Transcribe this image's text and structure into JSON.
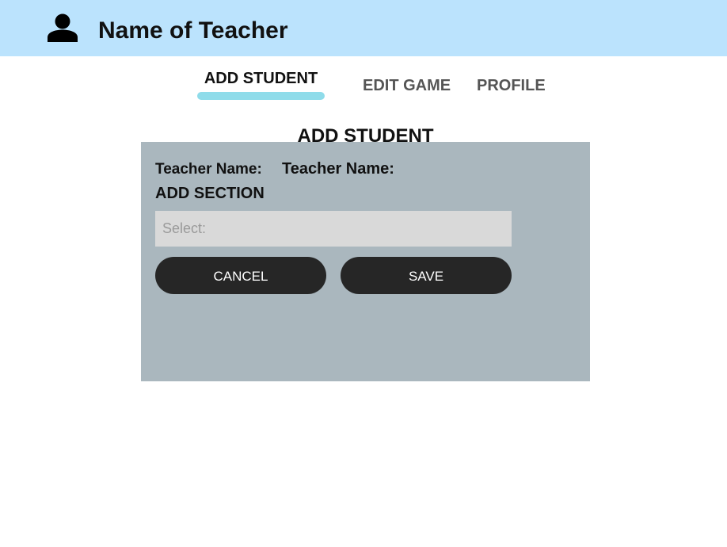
{
  "header": {
    "icon": "user-icon",
    "title": "Name of Teacher"
  },
  "tabs": [
    {
      "label": "ADD STUDENT",
      "active": true
    },
    {
      "label": "EDIT GAME",
      "active": false
    },
    {
      "label": "PROFILE",
      "active": false
    }
  ],
  "main": {
    "heading": "ADD STUDENT",
    "form": {
      "teacher_label": "Teacher Name:",
      "teacher_value": "Teacher Name:",
      "section_label": "ADD SECTION",
      "select_placeholder": "Select:",
      "cancel_label": "CANCEL",
      "save_label": "SAVE"
    }
  },
  "colors": {
    "header_bg": "#bbe3fd",
    "active_tab_indicator": "#8fdcea",
    "panel_bg": "#aab7be",
    "button_bg": "#262626",
    "select_bg": "#d9d9d9"
  }
}
